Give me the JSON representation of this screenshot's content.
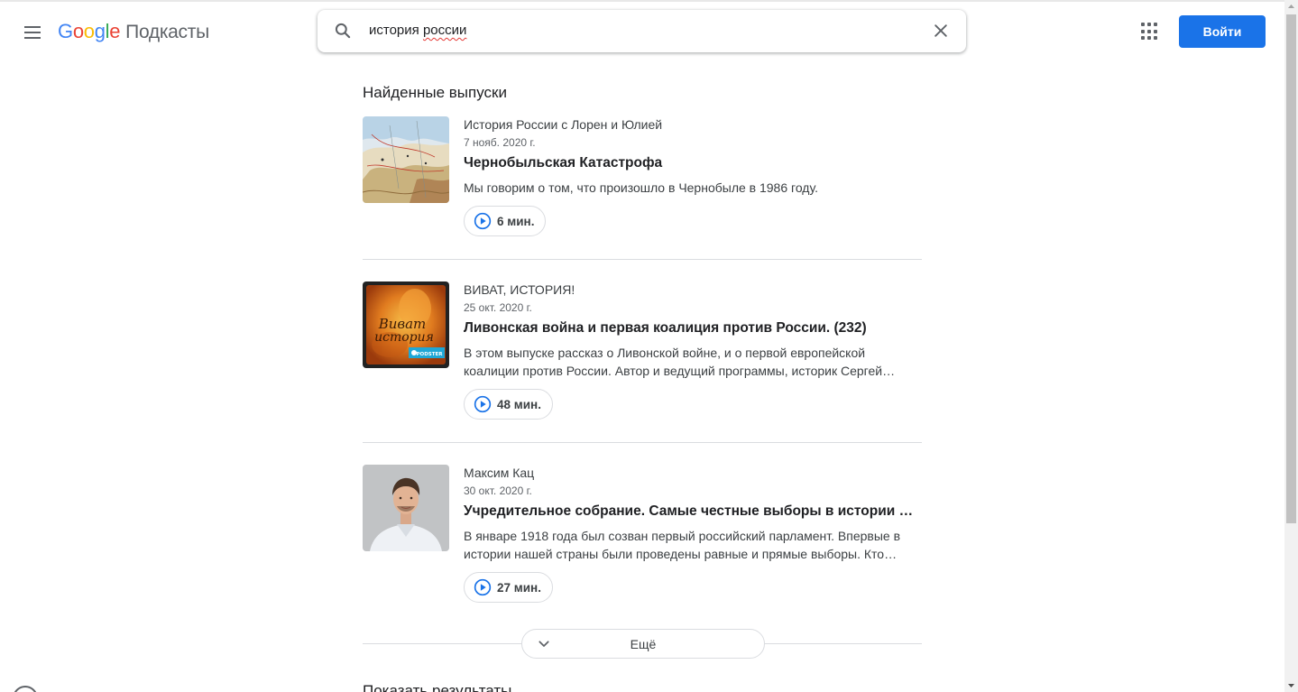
{
  "header": {
    "logo_letters": [
      "G",
      "o",
      "o",
      "g",
      "l",
      "e"
    ],
    "product": "Подкасты",
    "signin_label": "Войти"
  },
  "search": {
    "query_word1": "история",
    "query_word2": "россии",
    "clear_icon": "close-icon"
  },
  "results": {
    "section_title": "Найденные выпуски",
    "episodes": [
      {
        "podcast": "История России с Лорен и Юлией",
        "date": "7 нояб. 2020 г.",
        "title": "Чернобыльская Катастрофа",
        "description": "Мы говорим о том, что произошло в Чернобыле в 1986 году.",
        "duration": "6 мин."
      },
      {
        "podcast": "ВИВАТ, ИСТОРИЯ!",
        "date": "25 окт. 2020 г.",
        "title": "Ливонская война и первая коалиция против России. (232)",
        "description": "В этом выпуске рассказ о Ливонской войне, и о первой европейской коалиции против России. Автор и ведущий программы, историк Сергей Станиславович Бунтовский.",
        "duration": "48 мин.",
        "thumb_text": "Виват история",
        "thumb_badge": "PODSTER"
      },
      {
        "podcast": "Максим Кац",
        "date": "30 окт. 2020 г.",
        "title": "Учредительное собрание. Самые честные выборы в истории России",
        "description": "В январе 1918 года был созван первый российский парламент. Впервые в истории нашей страны были проведены равные и прямые выборы. Кто победил на этих выборах?",
        "duration": "27 мин."
      }
    ],
    "more_label": "Ещё",
    "next_section_title": "Показать результаты"
  },
  "colors": {
    "accent": "#1a73e8",
    "divider": "#dadce0"
  }
}
